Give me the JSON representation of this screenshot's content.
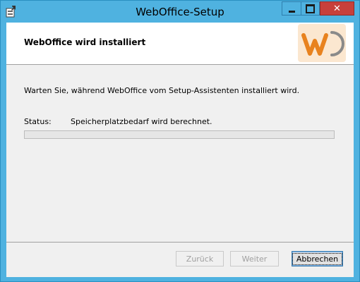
{
  "window": {
    "title": "WebOffice-Setup",
    "icon": "installer-icon",
    "controls": {
      "minimize": "minimize-icon",
      "maximize": "maximize-icon",
      "close": "close-icon",
      "close_glyph": "✕"
    },
    "colors": {
      "frame": "#4fb2e0",
      "close_button": "#c7403b"
    }
  },
  "banner": {
    "title": "WebOffice wird installiert",
    "logo": "weboffice-logo",
    "logo_colors": {
      "orange": "#e8821e",
      "gray": "#8a8a8a",
      "bg": "#fbe7d0"
    }
  },
  "main": {
    "description": "Warten Sie, während WebOffice vom Setup-Assistenten installiert wird.",
    "status_label": "Status:",
    "status_value": "Speicherplatzbedarf wird berechnet.",
    "progress": 0
  },
  "footer": {
    "back_label": "Zurück",
    "next_label": "Weiter",
    "cancel_label": "Abbrechen",
    "back_enabled": false,
    "next_enabled": false
  }
}
